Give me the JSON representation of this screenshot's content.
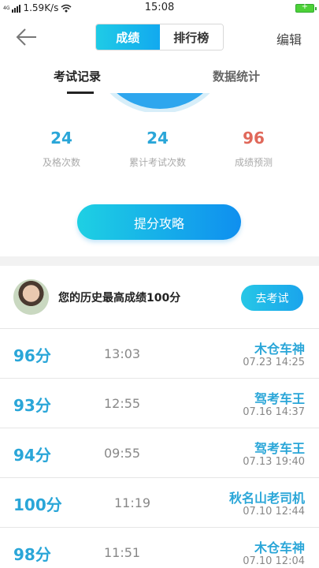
{
  "status_bar": {
    "signal_text": "4G",
    "network_speed": "1.59K/s",
    "time": "15:08",
    "battery": "+"
  },
  "nav": {
    "segments": [
      "成绩",
      "排行榜"
    ],
    "active_segment": "成绩",
    "edit_label": "编辑"
  },
  "tabs": [
    {
      "label": "考试记录",
      "active": true
    },
    {
      "label": "数据统计",
      "active": false
    }
  ],
  "stats": [
    {
      "value": "24",
      "label": "及格次数"
    },
    {
      "value": "24",
      "label": "累计考试次数"
    },
    {
      "value": "96",
      "label": "成绩预测"
    }
  ],
  "tips_button": "提分攻略",
  "best": {
    "text": "您的历史最高成绩100分",
    "button": "去考试"
  },
  "records": [
    {
      "score": "96分",
      "duration": "13:03",
      "title": "木仓车神",
      "date": "07.23  14:25"
    },
    {
      "score": "93分",
      "duration": "12:55",
      "title": "驾考车王",
      "date": "07.16  14:37"
    },
    {
      "score": "94分",
      "duration": "09:55",
      "title": "驾考车王",
      "date": "07.13  19:40"
    },
    {
      "score": "100分",
      "duration": "11:19",
      "title": "秋名山老司机",
      "date": "07.10  12:44"
    },
    {
      "score": "98分",
      "duration": "11:51",
      "title": "木仓车神",
      "date": "07.10  12:04"
    }
  ],
  "colors": {
    "accent": "#2aa6d8",
    "prediction": "#e0685a",
    "gradient_start": "#1ed0e3",
    "gradient_end": "#0f8fef"
  }
}
